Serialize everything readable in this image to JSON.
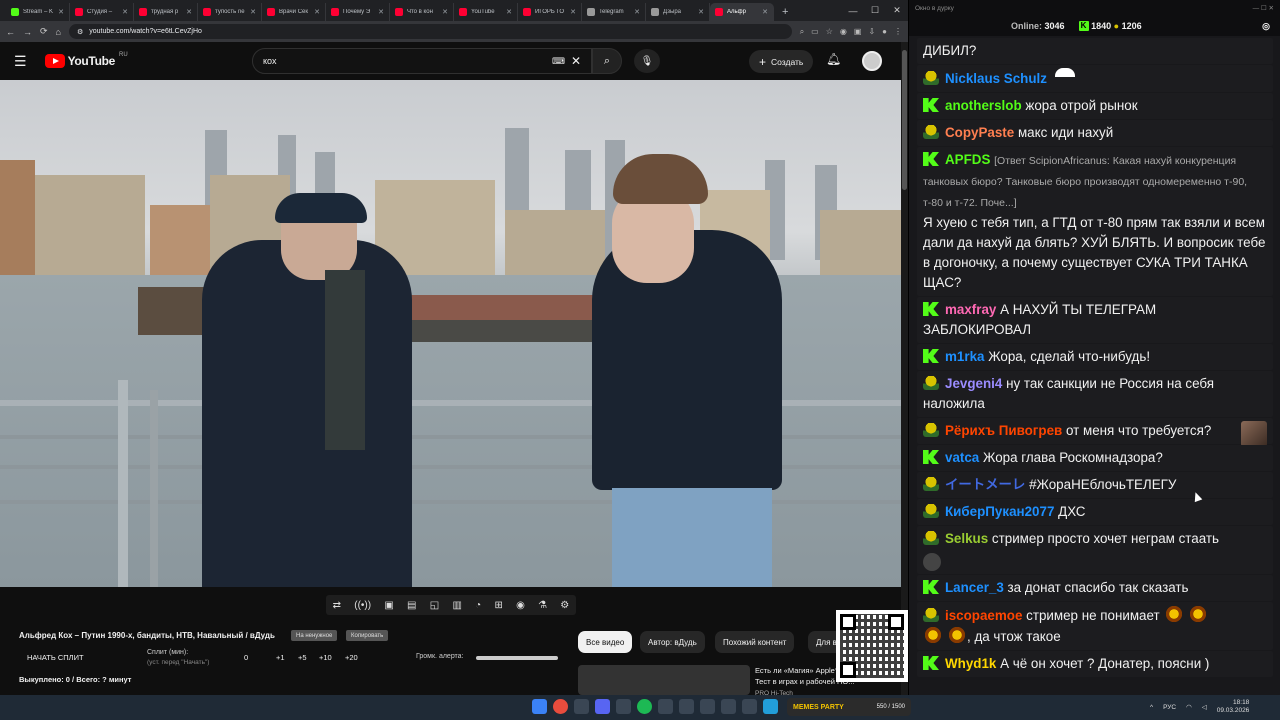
{
  "browser": {
    "tabs": [
      {
        "label": "Stream – K",
        "color": "#53fc18",
        "active": false
      },
      {
        "label": "Студия –",
        "color": "#ff0033",
        "active": false
      },
      {
        "label": "трудная р",
        "color": "#ff0033",
        "active": false
      },
      {
        "label": "тупость ne",
        "color": "#ff0033",
        "active": false
      },
      {
        "label": "Врачи Сек",
        "color": "#ff0033",
        "active": false
      },
      {
        "label": "Почему Э",
        "color": "#ff0033",
        "active": false
      },
      {
        "label": "Что в кон",
        "color": "#ff0033",
        "active": false
      },
      {
        "label": "YouTube",
        "color": "#ff0033",
        "active": false
      },
      {
        "label": "ИГОРЬ ГО",
        "color": "#ff0033",
        "active": false
      },
      {
        "label": "Telegram",
        "color": "#999",
        "active": false
      },
      {
        "label": "Дзыра",
        "color": "#999",
        "active": false
      },
      {
        "label": "Альфр",
        "color": "#ff0033",
        "active": true
      }
    ],
    "new_tab": "+",
    "url": "youtube.com/watch?v=e6tLCevZjHo"
  },
  "youtube": {
    "logo": "YouTube",
    "region": "RU",
    "search_query": "кох",
    "create_label": "Создать"
  },
  "under_video": {
    "title": "Альфред Кох – Путин 1990-х, бандиты, НТВ, Навальный / вДудь",
    "chip1": "На ненужное",
    "chip2": "Копировать",
    "split_label": "НАЧАТЬ СПЛИТ",
    "split_min_label": "Сплит (мин):",
    "split_min_hint": "(уст. перед \"Начать\")",
    "split_values": [
      "0",
      "+1",
      "+5",
      "+10",
      "+20"
    ],
    "alert_label": "Громк. алерта:",
    "bought": "Выкуплено: 0 / Всего: ? минут",
    "filter_chips": [
      "Все видео",
      "Автор: вДудь",
      "Похожий контент",
      "Для в"
    ],
    "rec_title": "Есть ли «Магия» Apple? Тест в играх и рабочей ПО...",
    "rec_channel": "PRO Hi-Tech"
  },
  "chat": {
    "window_title": "Окно в дурку",
    "online_label": "Online:",
    "online_value": "3046",
    "kick_count": "1840",
    "other_count": "1206",
    "messages": [
      {
        "name": "",
        "text": "ДИБИЛ?",
        "badge": "none",
        "color": "#ffffff"
      },
      {
        "name": "Nicklaus Schulz",
        "text": "",
        "badge": "hat",
        "color": "#1e90ff",
        "emote": "shoe"
      },
      {
        "name": "anotherslob",
        "text": "жора отрой рынок",
        "badge": "kick",
        "color": "#53fc18"
      },
      {
        "name": "CopyPaste",
        "text": "макс иди нахуй",
        "badge": "hat",
        "color": "#ff7f50"
      },
      {
        "name": "APFDS",
        "reply": "[Ответ ScipionAfricanus: Какая нахуй конкуренция танковых бюро? Танковые бюро производят одномеременно т-90, т-80 и т-72. Поче...]",
        "text": "Я хуею с тебя тип, а ГТД от т-80 прям так взяли и всем дали да нахуй да блять? ХУЙ БЛЯТЬ. И вопросик тебе в догоночку, а почему существует СУКА ТРИ ТАНКА ЩАС?",
        "badge": "kick",
        "color": "#53fc18"
      },
      {
        "name": "maxfray",
        "text": "А НАХУЙ ТЫ ТЕЛЕГРАМ ЗАБЛОКИРОВАЛ",
        "badge": "kick",
        "color": "#ff69b4"
      },
      {
        "name": "m1rka",
        "text": "Жора, сделай что-нибудь!",
        "badge": "kick",
        "color": "#1e90ff"
      },
      {
        "name": "Jevgeni4",
        "text": "ну так санкции не Россия на себя наложила",
        "badge": "hat",
        "color": "#9b8cff"
      },
      {
        "name": "Рёрихъ Пивогрев",
        "text": "от меня что требуется?",
        "badge": "hat",
        "color": "#ff4500",
        "emote": "face"
      },
      {
        "name": "vatca",
        "text": "Жора глава Роскомнадзора?",
        "badge": "kick",
        "color": "#1e90ff"
      },
      {
        "name": "イートメーレ",
        "text": "#ЖораНЕблочьТЕЛЕГУ",
        "badge": "hat",
        "color": "#4169e1"
      },
      {
        "name": "КиберПукан2077",
        "text": "ДХС",
        "badge": "hat",
        "color": "#1e90ff"
      },
      {
        "name": "Selkus",
        "text": "стример просто хочет неграм стаать",
        "badge": "hat",
        "color": "#9acd32",
        "avatar": true
      },
      {
        "name": "Lancer_3",
        "text": "за донат спасибо так сказать",
        "badge": "kick",
        "color": "#1e90ff"
      },
      {
        "name": "iscopaemoe",
        "text": "стример не понимает",
        "badge": "hat",
        "color": "#ff4500",
        "emote": "fire",
        "text2": ", да чтож такое"
      },
      {
        "name": "Whyd1k",
        "text": "А чё он хочет ? Донатер, поясни )",
        "badge": "kick",
        "color": "#ffd700"
      }
    ]
  },
  "taskbar": {
    "memes_label": "MEMES PARTY",
    "memes_value": "550 / 1500",
    "lang": "РУС",
    "time": "18:18",
    "date": "09.03.2026"
  }
}
